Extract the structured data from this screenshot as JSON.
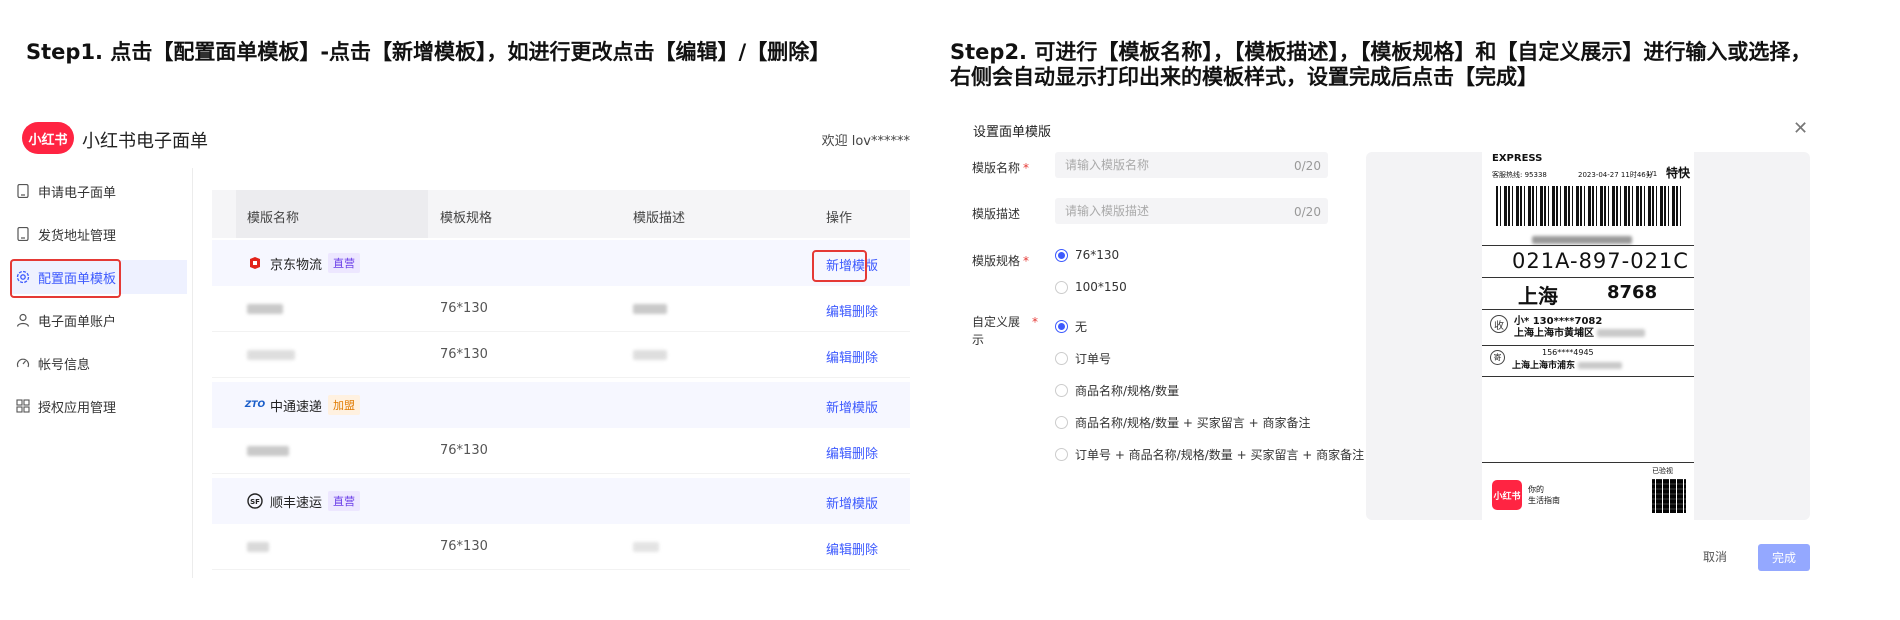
{
  "step1": {
    "title": "Step1. 点击【配置面单模板】-点击【新增模板】，如进行更改点击【编辑】/【删除】"
  },
  "step2": {
    "title_line1": "Step2. 可进行【模板名称】，【模板描述】，【模板规格】和【自定义展示】进行输入或选择，",
    "title_line2": "右侧会自动显示打印出来的模板样式，设置完成后点击【完成】"
  },
  "app": {
    "logo_text": "小红书",
    "name": "小红书电子面单",
    "welcome": "欢迎 lov******",
    "brand_color": "#ff2442",
    "accent_color": "#3d5afe"
  },
  "sidebar": {
    "items": [
      {
        "label": "申请电子面单",
        "icon": "tablet-icon"
      },
      {
        "label": "发货地址管理",
        "icon": "tablet-icon"
      },
      {
        "label": "配置面单模板",
        "icon": "gear-icon",
        "active": true
      },
      {
        "label": "电子面单账户",
        "icon": "user-icon"
      },
      {
        "label": "帐号信息",
        "icon": "dashboard-icon"
      },
      {
        "label": "授权应用管理",
        "icon": "grid-icon"
      }
    ]
  },
  "table": {
    "headers": [
      "模版名称",
      "模板规格",
      "模版描述",
      "操作"
    ],
    "add_label": "新增模版",
    "edit_label": "编辑",
    "delete_label": "删除",
    "groups": [
      {
        "carrier": "京东物流",
        "tag": "直营",
        "rows": [
          {
            "spec": "76*130"
          },
          {
            "spec": "76*130"
          }
        ]
      },
      {
        "carrier": "中通速递",
        "tag": "加盟",
        "rows": [
          {
            "spec": "76*130"
          }
        ]
      },
      {
        "carrier": "顺丰速运",
        "tag": "直营",
        "rows": [
          {
            "spec": "76*130"
          }
        ]
      }
    ]
  },
  "dialog": {
    "title": "设置面单模版",
    "close_icon": "close-icon",
    "name_label": "模版名称",
    "name_placeholder": "请输入模版名称",
    "name_counter": "0/20",
    "desc_label": "模版描述",
    "desc_placeholder": "请输入模版描述",
    "desc_counter": "0/20",
    "spec_label": "模版规格",
    "spec_options": [
      "76*130",
      "100*150"
    ],
    "spec_selected": "76*130",
    "custom_label_line1": "自定义展",
    "custom_label_line2": "示",
    "custom_options": [
      "无",
      "订单号",
      "商品名称/规格/数量",
      "商品名称/规格/数量 + 买家留言 + 商家备注",
      "订单号 + 商品名称/规格/数量 + 买家留言 + 商家备注"
    ],
    "custom_selected": "无",
    "cancel_label": "取消",
    "done_label": "完成"
  },
  "preview": {
    "express_text": "EXPRESS",
    "hotline": "客服热线: 95338",
    "print_time": "2023-04-27 11时46分",
    "page": "1/1",
    "service": "特快",
    "route_code": "021A-897-021C",
    "city": "上海",
    "city_code": "8768",
    "recipient_mark": "收",
    "recipient": "小*      130****7082",
    "recipient_addr": "上海上海市黄埔区",
    "sender_mark": "寄",
    "sender_phone": "156****4945",
    "sender_addr": "上海上海市浦东",
    "checked": "已验视",
    "slogan_line1": "你的",
    "slogan_line2": "生活指南",
    "logo_text": "小红书"
  }
}
